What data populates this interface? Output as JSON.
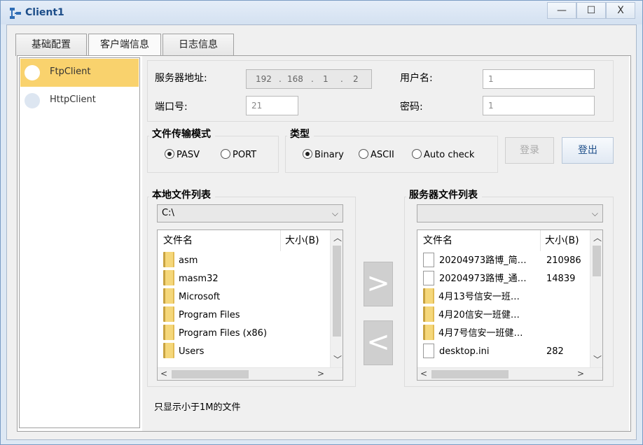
{
  "window": {
    "title": "Client1",
    "minimize": "—",
    "maximize": "☐",
    "close": "X"
  },
  "tabs": [
    {
      "label": "基础配置"
    },
    {
      "label": "客户端信息"
    },
    {
      "label": "日志信息"
    }
  ],
  "sidebar": {
    "items": [
      {
        "label": "FtpClient",
        "active": true
      },
      {
        "label": "HttpClient",
        "active": false
      }
    ]
  },
  "server": {
    "address_label": "服务器地址:",
    "ip": [
      "192",
      "168",
      "1",
      "2"
    ],
    "port_label": "端口号:",
    "port_value": "21",
    "username_label": "用户名:",
    "username_value": "1",
    "password_label": "密码:",
    "password_value": "1"
  },
  "transfer_mode": {
    "title": "文件传输模式",
    "options": [
      {
        "label": "PASV",
        "checked": true
      },
      {
        "label": "PORT",
        "checked": false
      }
    ]
  },
  "type_group": {
    "title": "类型",
    "options": [
      {
        "label": "Binary",
        "checked": true
      },
      {
        "label": "ASCII",
        "checked": false
      },
      {
        "label": "Auto check",
        "checked": false
      }
    ]
  },
  "buttons": {
    "login": "登录",
    "logout": "登出"
  },
  "local": {
    "title": "本地文件列表",
    "path": "C:\\",
    "col_name": "文件名",
    "col_size": "大小(B)",
    "rows": [
      {
        "name": "asm",
        "size": "",
        "kind": "folder"
      },
      {
        "name": "masm32",
        "size": "",
        "kind": "folder"
      },
      {
        "name": "Microsoft",
        "size": "",
        "kind": "folder"
      },
      {
        "name": "Program Files",
        "size": "",
        "kind": "folder"
      },
      {
        "name": "Program Files (x86)",
        "size": "",
        "kind": "folder"
      },
      {
        "name": "Users",
        "size": "",
        "kind": "folder"
      }
    ]
  },
  "remote": {
    "title": "服务器文件列表",
    "path": "",
    "col_name": "文件名",
    "col_size": "大小(B)",
    "rows": [
      {
        "name": "20204973路博_简…",
        "size": "210986",
        "kind": "file"
      },
      {
        "name": "20204973路博_通…",
        "size": "14839",
        "kind": "file"
      },
      {
        "name": "4月13号信安一班…",
        "size": "",
        "kind": "folder"
      },
      {
        "name": "4月20信安一班健…",
        "size": "",
        "kind": "folder"
      },
      {
        "name": "4月7号信安一班健…",
        "size": "",
        "kind": "folder"
      },
      {
        "name": "desktop.ini",
        "size": "282",
        "kind": "file"
      }
    ]
  },
  "arrows": {
    "upload": ">",
    "download": "<"
  },
  "note": "只显示小于1M的文件",
  "icons": {
    "app": "network-client-icon",
    "folder": "folder-icon",
    "file": "file-icon"
  },
  "colors": {
    "active_item": "#f9d26d",
    "title_text": "#1d4e89"
  }
}
